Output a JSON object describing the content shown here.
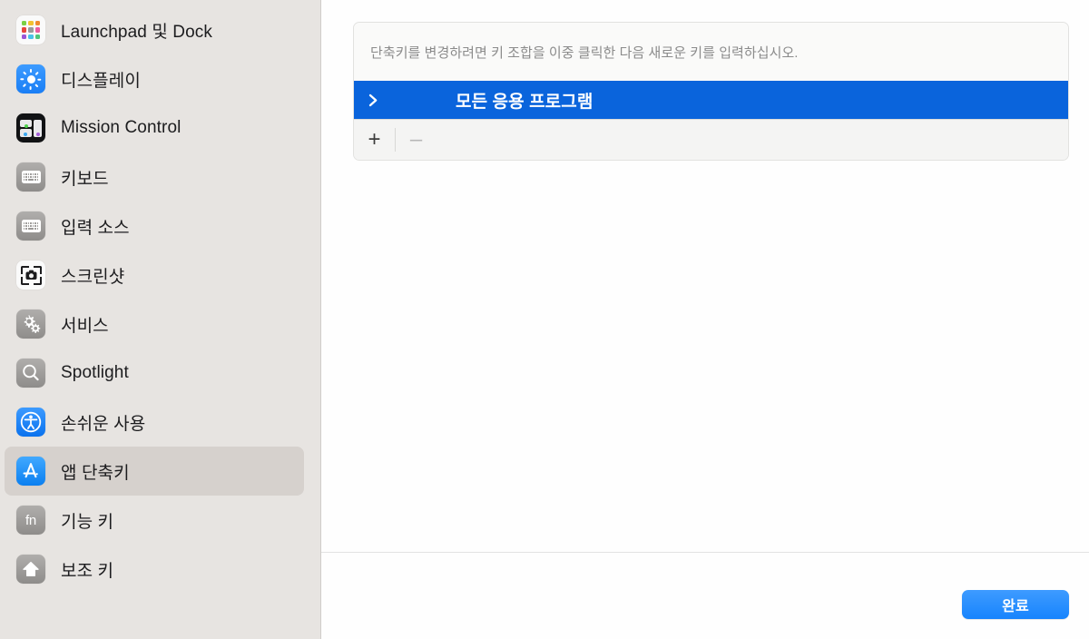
{
  "sidebar": {
    "items": [
      {
        "label": "Launchpad 및 Dock",
        "icon": "launchpad-icon",
        "selected": false
      },
      {
        "label": "디스플레이",
        "icon": "display-brightness-icon",
        "selected": false
      },
      {
        "label": "Mission Control",
        "icon": "mission-control-icon",
        "selected": false
      },
      {
        "label": "키보드",
        "icon": "keyboard-icon",
        "selected": false
      },
      {
        "label": "입력 소스",
        "icon": "input-sources-keyboard-icon",
        "selected": false
      },
      {
        "label": "스크린샷",
        "icon": "screenshot-camera-icon",
        "selected": false
      },
      {
        "label": "서비스",
        "icon": "services-gears-icon",
        "selected": false
      },
      {
        "label": "Spotlight",
        "icon": "spotlight-search-icon",
        "selected": false
      },
      {
        "label": "손쉬운 사용",
        "icon": "accessibility-icon",
        "selected": false
      },
      {
        "label": "앱 단축키",
        "icon": "app-store-icon",
        "selected": true
      },
      {
        "label": "기능 키",
        "icon": "function-key-fn-icon",
        "selected": false
      },
      {
        "label": "보조 키",
        "icon": "modifier-key-shift-icon",
        "selected": false
      }
    ]
  },
  "panel": {
    "help_text": "단축키를 변경하려면 키 조합을 이중 클릭한 다음 새로운 키를 입력하십시오.",
    "group_row": {
      "title": "모든 응용 프로그램",
      "disclosure_icon": "chevron-right-icon",
      "expanded": false,
      "selected": true
    },
    "toolbar": {
      "add_label": "+",
      "add_icon": "plus-icon",
      "remove_label": "–",
      "remove_icon": "minus-icon",
      "remove_disabled": true
    }
  },
  "footer": {
    "done_label": "완료"
  },
  "colors": {
    "selection_blue": "#0a64dc",
    "accent_button": "#1784fd",
    "sidebar_background": "#e7e4e1",
    "sidebar_selected": "#d6d1cd"
  }
}
